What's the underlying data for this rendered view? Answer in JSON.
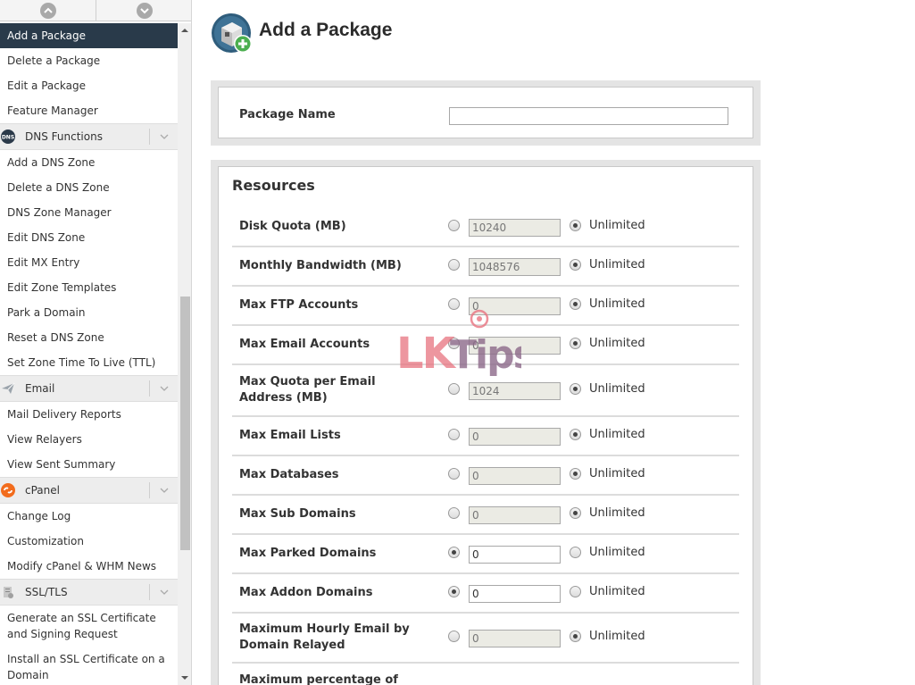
{
  "sidebar": {
    "items": [
      {
        "type": "item",
        "label": "Add a Package",
        "active": true
      },
      {
        "type": "item",
        "label": "Delete a Package"
      },
      {
        "type": "item",
        "label": "Edit a Package"
      },
      {
        "type": "item",
        "label": "Feature Manager"
      },
      {
        "type": "group",
        "label": "DNS Functions",
        "icon": "dns-icon"
      },
      {
        "type": "item",
        "label": "Add a DNS Zone"
      },
      {
        "type": "item",
        "label": "Delete a DNS Zone"
      },
      {
        "type": "item",
        "label": "DNS Zone Manager"
      },
      {
        "type": "item",
        "label": "Edit DNS Zone"
      },
      {
        "type": "item",
        "label": "Edit MX Entry"
      },
      {
        "type": "item",
        "label": "Edit Zone Templates"
      },
      {
        "type": "item",
        "label": "Park a Domain"
      },
      {
        "type": "item",
        "label": "Reset a DNS Zone"
      },
      {
        "type": "item",
        "label": "Set Zone Time To Live (TTL)"
      },
      {
        "type": "group",
        "label": "Email",
        "icon": "email-icon"
      },
      {
        "type": "item",
        "label": "Mail Delivery Reports"
      },
      {
        "type": "item",
        "label": "View Relayers"
      },
      {
        "type": "item",
        "label": "View Sent Summary"
      },
      {
        "type": "group",
        "label": "cPanel",
        "icon": "cpanel-icon"
      },
      {
        "type": "item",
        "label": "Change Log"
      },
      {
        "type": "item",
        "label": "Customization"
      },
      {
        "type": "item",
        "label": "Modify cPanel & WHM News"
      },
      {
        "type": "group",
        "label": "SSL/TLS",
        "icon": "ssl-icon"
      },
      {
        "type": "item",
        "label": "Generate an SSL Certificate and Signing Request",
        "two_line": true
      },
      {
        "type": "item",
        "label": "Install an SSL Certificate on a Domain",
        "two_line": true
      }
    ],
    "dns_badge": "DNS"
  },
  "main": {
    "title": "Add a Package",
    "package_name": {
      "label": "Package Name",
      "value": ""
    },
    "resources": {
      "title": "Resources",
      "unlimited_label": "Unlimited",
      "rows": [
        {
          "label": "Disk Quota (MB)",
          "value": "10240",
          "unlimited": true
        },
        {
          "label": "Monthly Bandwidth (MB)",
          "value": "1048576",
          "unlimited": true
        },
        {
          "label": "Max FTP Accounts",
          "value": "0",
          "unlimited": true
        },
        {
          "label": "Max Email Accounts",
          "value": "0",
          "unlimited": true
        },
        {
          "label": "Max Quota per Email Address (MB)",
          "value": "1024",
          "unlimited": true
        },
        {
          "label": "Max Email Lists",
          "value": "0",
          "unlimited": true
        },
        {
          "label": "Max Databases",
          "value": "0",
          "unlimited": true
        },
        {
          "label": "Max Sub Domains",
          "value": "0",
          "unlimited": true
        },
        {
          "label": "Max Parked Domains",
          "value": "0",
          "unlimited": false
        },
        {
          "label": "Max Addon Domains",
          "value": "0",
          "unlimited": false
        },
        {
          "label": "Maximum Hourly Email by Domain Relayed",
          "value": "0",
          "unlimited": true
        },
        {
          "label": "Maximum percentage of",
          "value": "",
          "unlimited": true
        }
      ]
    }
  },
  "watermark": {
    "text_lk": "LK",
    "text_tips": "Tips"
  },
  "colors": {
    "active_nav": "#293a4a",
    "cpanel_orange": "#f26c1d",
    "watermark_pink": "#e8737f",
    "watermark_purple": "#8d6a8a"
  }
}
